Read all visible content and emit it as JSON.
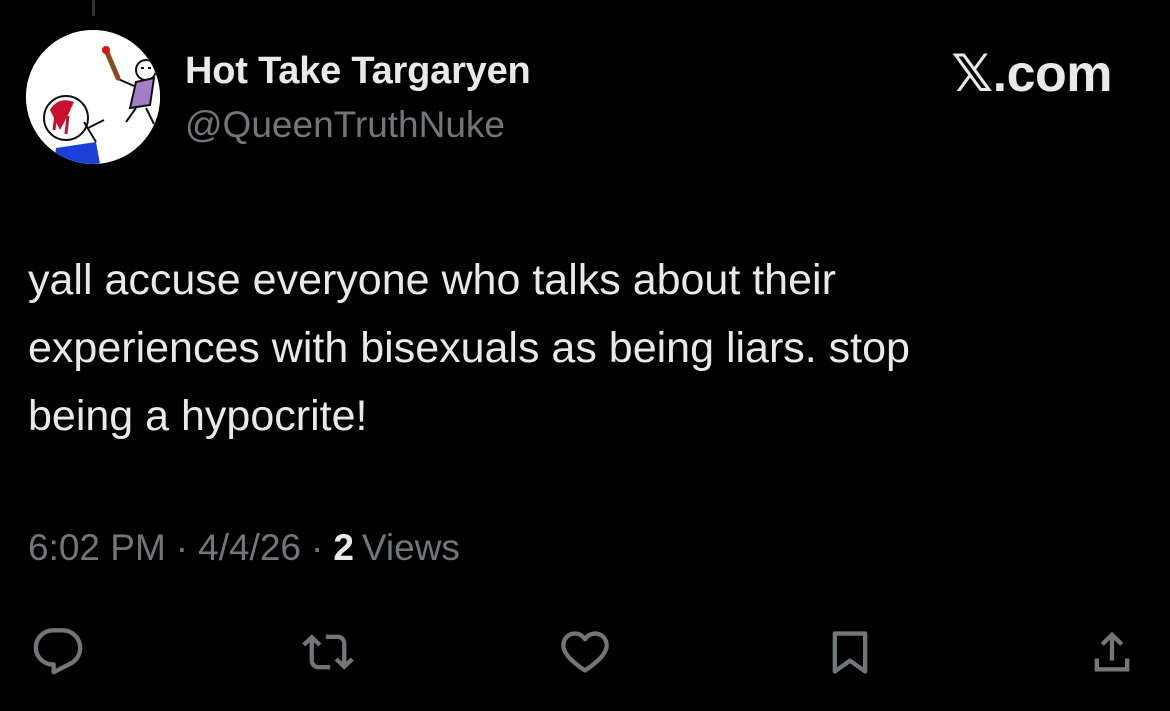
{
  "tweet": {
    "author": {
      "display_name": "Hot Take Targaryen",
      "handle": "@QueenTruthNuke"
    },
    "brand": "𝕏.com",
    "text": "yall accuse everyone who talks about their\nexperiences with bisexuals as being liars. stop\nbeing a hypocrite!",
    "time": "6:02 PM",
    "date": "4/4/26",
    "separator": "·",
    "views_count": "2",
    "views_label": "Views"
  },
  "actions": [
    {
      "icon": "reply-icon"
    },
    {
      "icon": "retweet-icon"
    },
    {
      "icon": "like-icon"
    },
    {
      "icon": "bookmark-icon"
    },
    {
      "icon": "share-icon"
    }
  ],
  "colors": {
    "background": "#000000",
    "primary_text": "#e7e9ea",
    "secondary_text": "#71767b"
  }
}
